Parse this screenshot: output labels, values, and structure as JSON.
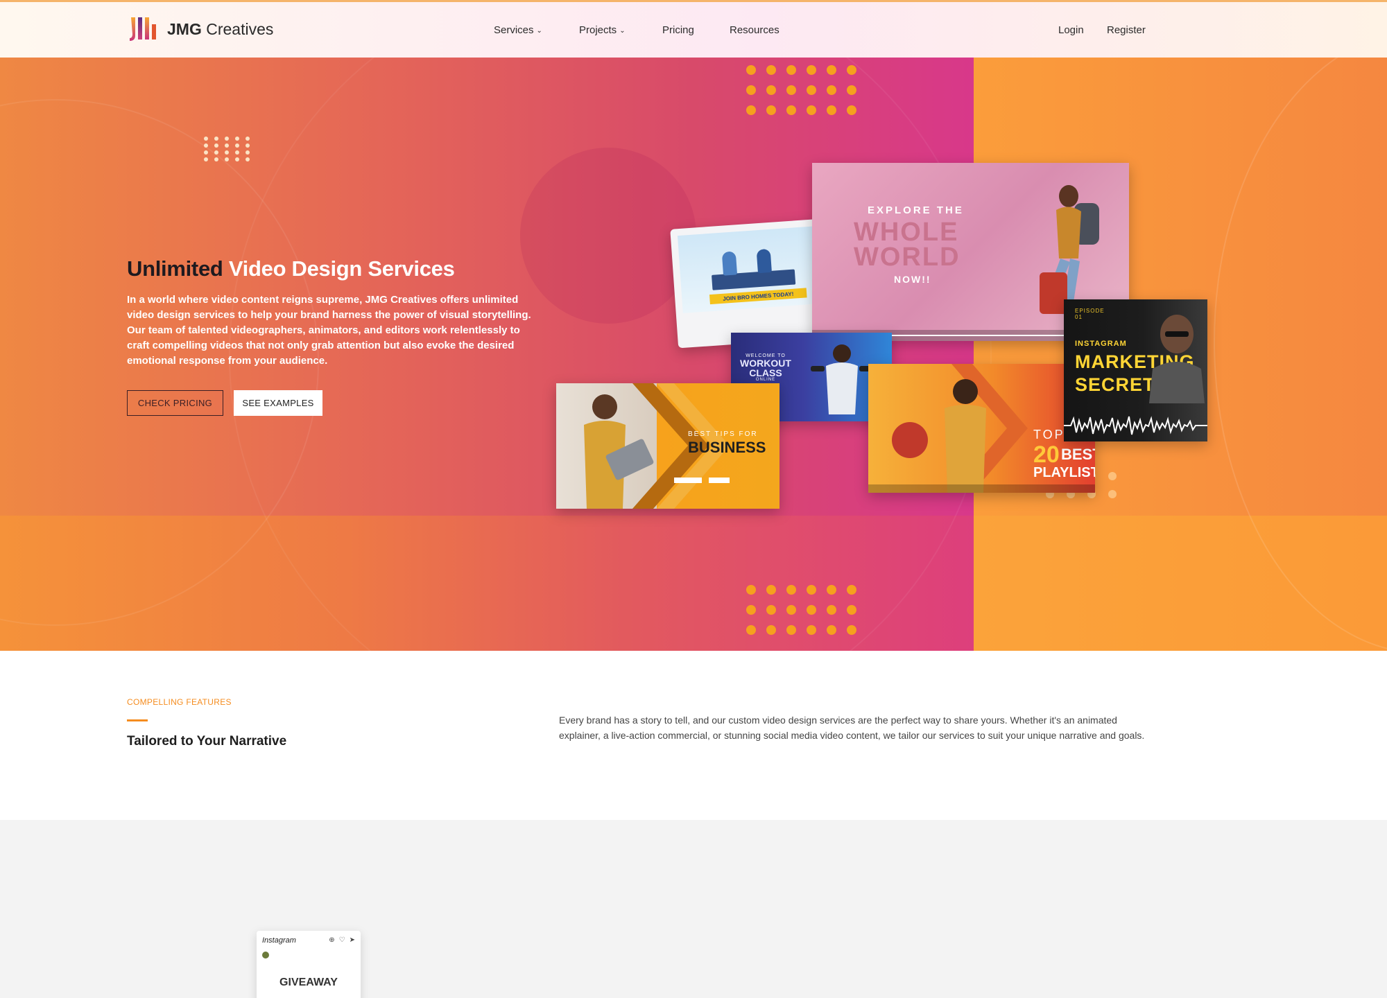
{
  "nav": {
    "logo_bold": "JMG",
    "logo_light": "Creatives",
    "items": [
      {
        "label": "Services",
        "has_dropdown": true
      },
      {
        "label": "Projects",
        "has_dropdown": true
      },
      {
        "label": "Pricing",
        "has_dropdown": false
      },
      {
        "label": "Resources",
        "has_dropdown": false
      }
    ],
    "login": "Login",
    "register": "Register"
  },
  "hero": {
    "title_dark": "Unlimited",
    "title_light": "Video Design Services",
    "description": "In a world where video content reigns supreme, JMG Creatives offers unlimited video design services to help your brand harness the power of visual storytelling. Our team of talented videographers, animators, and editors work relentlessly to craft compelling videos that not only grab attention but also evoke the desired emotional response from your audience.",
    "btn_pricing": "CHECK PRICING",
    "btn_examples": "SEE EXAMPLES",
    "cards": {
      "laptop_banner": "JOIN BRO HOMES TODAY!",
      "explore_small": "EXPLORE THE",
      "explore_big_1": "WHOLE",
      "explore_big_2": "WORLD",
      "explore_now": "NOW!!",
      "workout_1": "WELCOME TO",
      "workout_2": "WORKOUT",
      "workout_3": "CLASS",
      "workout_4": "ONLINE",
      "biz_small": "BEST TIPS FOR",
      "biz_big": "BUSINESS",
      "pl_top": "TOP",
      "pl_20": "20",
      "pl_best": "BEST",
      "pl_playlist": "PLAYLIST",
      "mk_episode": "EPISODE",
      "mk_episode_num": "01",
      "mk_insta": "INSTAGRAM",
      "mk_big_1": "MARKETING",
      "mk_big_2": "SECRETS"
    }
  },
  "features": {
    "eyebrow": "COMPELLING FEATURES",
    "title": "Tailored to Your Narrative",
    "description": "Every brand has a story to tell, and our custom video design services are the perfect way to share yours. Whether it's an animated explainer, a live-action commercial, or stunning social media video content, we tailor our services to suit your unique narrative and goals."
  },
  "lower": {
    "phone_app": "Instagram",
    "giveaway": "GIVEAWAY"
  },
  "colors": {
    "accent_orange": "#f58c1f",
    "hero_pink": "#d93f74",
    "hero_orange": "#fb9a3a"
  },
  "icons": [
    "logo-mark",
    "chevron-down-icon",
    "play-controls-icon",
    "audio-wave-icon"
  ]
}
